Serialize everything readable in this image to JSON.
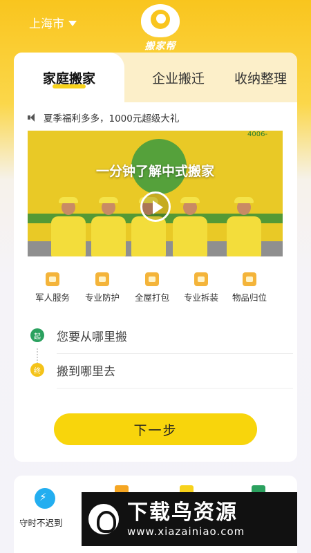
{
  "header": {
    "city": "上海市",
    "logo_text": "搬家帮"
  },
  "tabs": [
    {
      "label": "家庭搬家",
      "active": true
    },
    {
      "label": "企业搬迁",
      "active": false
    },
    {
      "label": "收纳整理",
      "active": false
    }
  ],
  "notice": {
    "text": "夏季福利多多，1000元超级大礼"
  },
  "banner": {
    "title": "一分钟了解中式搬家",
    "phone_fragment": "4006-"
  },
  "services": [
    {
      "label": "军人服务",
      "icon": "soldier-icon"
    },
    {
      "label": "专业防护",
      "icon": "shield-icon"
    },
    {
      "label": "全屋打包",
      "icon": "package-icon"
    },
    {
      "label": "专业拆装",
      "icon": "toolbox-icon"
    },
    {
      "label": "物品归位",
      "icon": "box-icon"
    }
  ],
  "address": {
    "start_marker": "起",
    "start_placeholder": "您要从哪里搬",
    "end_marker": "终",
    "end_placeholder": "搬到哪里去"
  },
  "actions": {
    "next_label": "下一步"
  },
  "promises": {
    "first_label": "守时不迟到"
  },
  "watermark": {
    "brand": "下载鸟资源",
    "url": "www.xiazainiao.com"
  },
  "colors": {
    "brand_yellow": "#f8d50c",
    "start_green": "#2ba15f",
    "end_yellow": "#f4c31a",
    "promise_blue": "#23aef0"
  }
}
